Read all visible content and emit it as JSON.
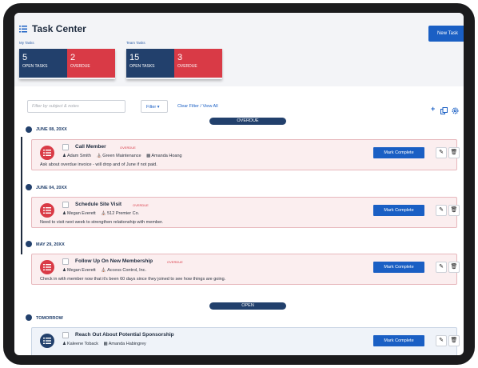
{
  "app": {
    "title": "Task Center",
    "new_task_label": "New Task"
  },
  "summary": {
    "my_tasks": {
      "label": "My Tasks",
      "open_count": "5",
      "open_label": "OPEN TASKS",
      "overdue_count": "2",
      "overdue_label": "OVERDUE"
    },
    "team_tasks": {
      "label": "Team Tasks",
      "open_count": "15",
      "open_label": "OPEN TASKS",
      "overdue_count": "3",
      "overdue_label": "OVERDUE"
    }
  },
  "filters": {
    "placeholder": "Filter by subject & notes",
    "filter_label": "Filter ▾",
    "clear_label": "Clear Filter / View All"
  },
  "toolbar": {
    "add_icon": "+",
    "copy_icon": "copy",
    "settings_icon": "gear"
  },
  "sections": {
    "overdue": "OVERDUE",
    "open": "OPEN"
  },
  "overdue_groups": [
    {
      "date": "JUNE 08, 20XX",
      "task": {
        "title": "Call Member",
        "status": "OVERDUE",
        "assignee": "Adam Smith",
        "company": "Green Maintenance",
        "contact": "Amanda Hoang",
        "note": "Ask about overdue invoice - will drop and of June if not paid.",
        "action": "Mark Complete"
      }
    },
    {
      "date": "JUNE 04, 20XX",
      "task": {
        "title": "Schedule Site Visit",
        "status": "OVERDUE",
        "assignee": "Megan Everett",
        "company": "512 Premier Co.",
        "note": "Need to visit next week to strengthen relationship with member.",
        "action": "Mark Complete"
      }
    },
    {
      "date": "MAY 29, 20XX",
      "task": {
        "title": "Follow Up On New Membership",
        "status": "OVERDUE",
        "assignee": "Megan Everett",
        "company": "Access Control, Inc.",
        "note": "Check in with member now that it's been 60 days since they joined to see how things are going.",
        "action": "Mark Complete"
      }
    }
  ],
  "open_groups": [
    {
      "date": "TOMORROW",
      "task": {
        "title": "Reach Out About Potential Sponsorship",
        "assignee": "Kaleene Toback",
        "contact": "Amanda Habingrey",
        "action": "Mark Complete"
      }
    }
  ],
  "colors": {
    "navy": "#22406c",
    "red": "#d93a46",
    "blue": "#1a5fc4",
    "bezel": "#1b1b1d"
  }
}
